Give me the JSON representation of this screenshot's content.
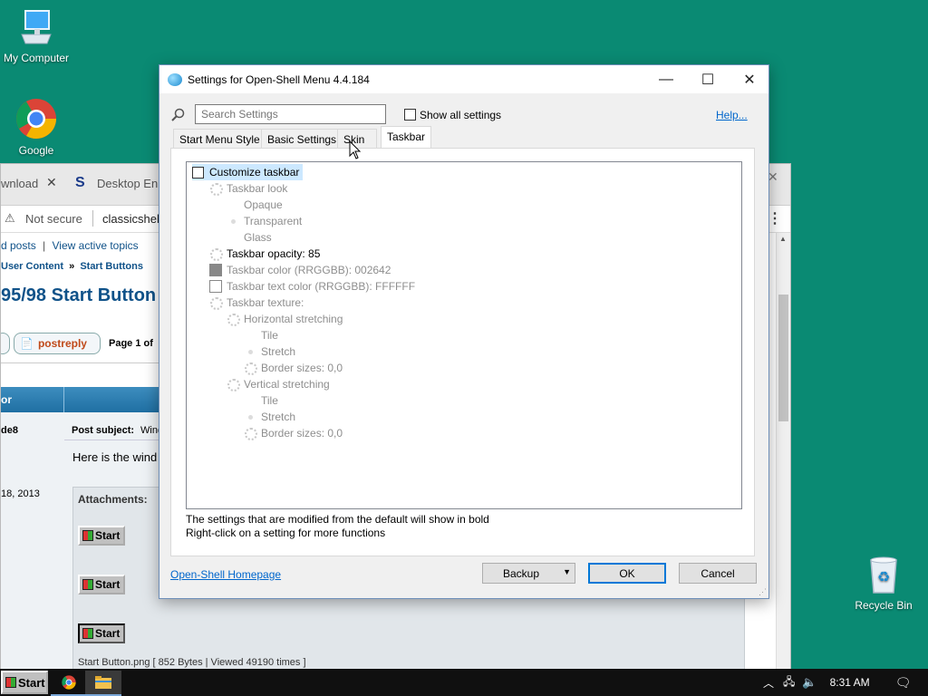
{
  "desktop": {
    "icons": [
      {
        "label": "My Computer",
        "icon": "computer-icon"
      },
      {
        "label": "Google",
        "icon": "chrome-icon"
      },
      {
        "label": "Recycle Bin",
        "icon": "recycle-bin-icon"
      }
    ]
  },
  "browser": {
    "tabs": [
      {
        "label": "wnload"
      },
      {
        "label": "Desktop Enha"
      }
    ],
    "security": "Not secure",
    "url": "classicshel",
    "links": {
      "posts": "d posts",
      "sep": "|",
      "active": "View active topics"
    },
    "breadcrumb": {
      "part1": "User Content",
      "sep": "»",
      "part2": "Start Buttons"
    },
    "page_title": "95/98 Start Button",
    "postreply": "postreply",
    "page_info": "Page 1 of",
    "table_head": "or",
    "author": "de8",
    "subject_label": "Post subject:",
    "subject_value": "Wind",
    "post_text": "Here is the wind",
    "date": "18, 2013",
    "attachments_label": "Attachments:",
    "start_label": "Start",
    "file_info": "Start Button.png [ 852 Bytes | Viewed 49190 times ]"
  },
  "dialog": {
    "title": "Settings for Open-Shell Menu 4.4.184",
    "search": {
      "placeholder": "Search Settings"
    },
    "show_all": "Show all settings",
    "help": "Help...",
    "tabs": [
      {
        "label": "Start Menu Style",
        "active": false
      },
      {
        "label": "Basic Settings",
        "active": false
      },
      {
        "label": "Skin",
        "active": false
      },
      {
        "label": "Taskbar",
        "active": true
      }
    ],
    "tree": [
      {
        "label": "Customize taskbar",
        "type": "checkbox",
        "checked": false,
        "style": "selected"
      },
      {
        "label": "Taskbar look",
        "type": "gear",
        "style": "dim"
      },
      {
        "label": "Opaque",
        "type": "none",
        "style": "dim"
      },
      {
        "label": "Transparent",
        "type": "bullet",
        "style": "dim"
      },
      {
        "label": "Glass",
        "type": "none",
        "style": "dim"
      },
      {
        "label": "Taskbar opacity: 85",
        "type": "gear",
        "style": "normal"
      },
      {
        "label": "Taskbar color (RRGGBB): 002642",
        "type": "swatch",
        "color": "#888888",
        "style": "dim"
      },
      {
        "label": "Taskbar text color (RRGGBB): FFFFFF",
        "type": "swatch",
        "color": "#FFFFFF",
        "style": "dim"
      },
      {
        "label": "Taskbar texture:",
        "type": "gear",
        "style": "dim"
      },
      {
        "label": "Horizontal stretching",
        "type": "gear",
        "style": "dim"
      },
      {
        "label": "Tile",
        "type": "none",
        "style": "dim"
      },
      {
        "label": "Stretch",
        "type": "bullet",
        "style": "dim"
      },
      {
        "label": "Border sizes: 0,0",
        "type": "gear",
        "style": "dim"
      },
      {
        "label": "Vertical stretching",
        "type": "gear",
        "style": "dim"
      },
      {
        "label": "Tile",
        "type": "none",
        "style": "dim"
      },
      {
        "label": "Stretch",
        "type": "bullet",
        "style": "dim"
      },
      {
        "label": "Border sizes: 0,0",
        "type": "gear",
        "style": "dim"
      }
    ],
    "note_line1": "The settings that are modified from the default will show in bold",
    "note_line2": "Right-click on a setting for more functions",
    "homepage": "Open-Shell Homepage",
    "buttons": {
      "backup": "Backup",
      "ok": "OK",
      "cancel": "Cancel"
    }
  },
  "taskbar": {
    "start": "Start",
    "time": "8:31 AM"
  },
  "colors": {
    "desktop": "#0a8a73",
    "accent": "#0078d7",
    "selected_bg": "#cce8ff"
  }
}
